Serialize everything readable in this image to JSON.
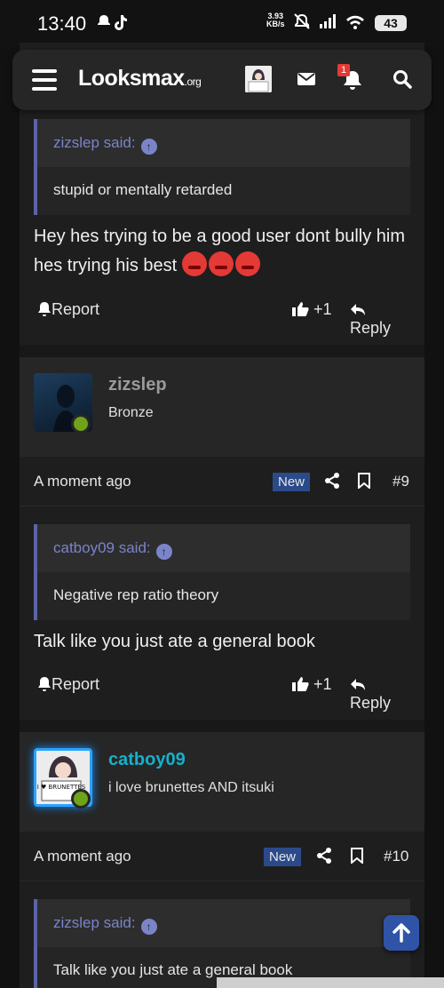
{
  "status_bar": {
    "time": "13:40",
    "net_speed_top": "3.93",
    "net_speed_bottom": "KB/s",
    "battery": "43"
  },
  "header": {
    "logo_main": "Looksmax",
    "logo_suffix": ".org",
    "notification_count": "1"
  },
  "posts": [
    {
      "quote_author": "zizslep said:",
      "quote_text": "stupid or mentally retarded",
      "body": "Hey hes trying to be a good user dont bully him hes trying his best",
      "actions": {
        "report": "Report",
        "like": "+1",
        "reply": "Reply"
      }
    },
    {
      "user": {
        "name": "zizslep",
        "title": "Bronze"
      },
      "meta": {
        "time": "A moment ago",
        "badge": "New",
        "number": "#9"
      },
      "quote_author": "catboy09 said:",
      "quote_text": "Negative rep ratio theory",
      "body": "Talk like you just ate a general book",
      "actions": {
        "report": "Report",
        "like": "+1",
        "reply": "Reply"
      }
    },
    {
      "user": {
        "name": "catboy09",
        "title": "i love brunettes AND itsuki"
      },
      "meta": {
        "time": "A moment ago",
        "badge": "New",
        "number": "#10"
      },
      "quote_author": "zizslep said:",
      "quote_text": "Talk like you just ate a general book"
    }
  ],
  "avatar_sign_text": "I ♥ BRUNETTES",
  "colors": {
    "quote_link": "#7a84c9",
    "quote_bar": "#5c63a8",
    "online": "#6fa31a",
    "new_badge": "#2b4a8a",
    "catboy_name": "#16b0c9",
    "scroll_top_button": "#2f53a6"
  }
}
